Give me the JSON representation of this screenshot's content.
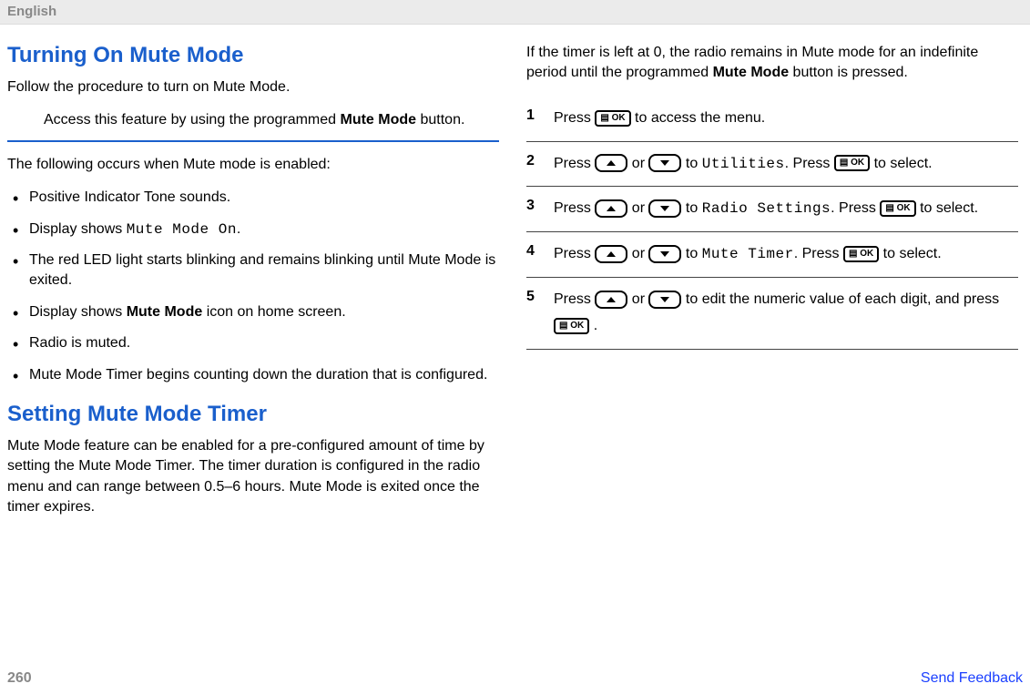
{
  "header": {
    "language": "English"
  },
  "left": {
    "section1_title": "Turning On Mute Mode",
    "intro1": "Follow the procedure to turn on Mute Mode.",
    "instruction_pre": "Access this feature by using the programmed ",
    "instruction_bold": "Mute Mode",
    "instruction_post": " button.",
    "enabled_intro": "The following occurs when Mute mode is enabled:",
    "bullets": [
      {
        "text": "Positive Indicator Tone sounds."
      },
      {
        "pre": "Display shows ",
        "dotted": "Mute Mode On",
        "post": "."
      },
      {
        "text": "The red LED light starts blinking and remains blinking until Mute Mode is exited."
      },
      {
        "pre": "Display shows ",
        "bold": "Mute Mode",
        "post": " icon on home screen."
      },
      {
        "text": "Radio is muted."
      },
      {
        "text": "Mute Mode Timer begins counting down the duration that is configured."
      }
    ],
    "section2_title": "Setting Mute Mode Timer",
    "section2_body": "Mute Mode feature can be enabled for a pre-configured amount of time by setting the Mute Mode Timer. The timer duration is configured in the radio menu and can range between 0.5–6 hours. Mute Mode is exited once the timer expires."
  },
  "right": {
    "note_pre": "If the timer is left at 0, the radio remains in Mute mode for an indefinite period until the programmed ",
    "note_bold": "Mute Mode",
    "note_post": " button is pressed.",
    "steps": {
      "s1": {
        "num": "1",
        "pre": "Press ",
        "post": " to access the menu."
      },
      "s2": {
        "num": "2",
        "pre": "Press ",
        "or": " or ",
        "to": " to ",
        "dotted": "Utilities",
        "press": ". Press ",
        "post": " to select."
      },
      "s3": {
        "num": "3",
        "pre": "Press ",
        "or": " or ",
        "to": " to ",
        "dotted": "Radio Settings",
        "press": ". Press ",
        "post": " to select."
      },
      "s4": {
        "num": "4",
        "pre": "Press ",
        "or": " or ",
        "to": " to ",
        "dotted": "Mute Timer",
        "press": ". Press ",
        "post": " to select."
      },
      "s5": {
        "num": "5",
        "pre": "Press ",
        "or": " or ",
        "mid": " to edit the numeric value of each digit, and press ",
        "post": " ."
      }
    },
    "ok_label": "▤ OK"
  },
  "footer": {
    "page": "260",
    "feedback": "Send Feedback"
  }
}
